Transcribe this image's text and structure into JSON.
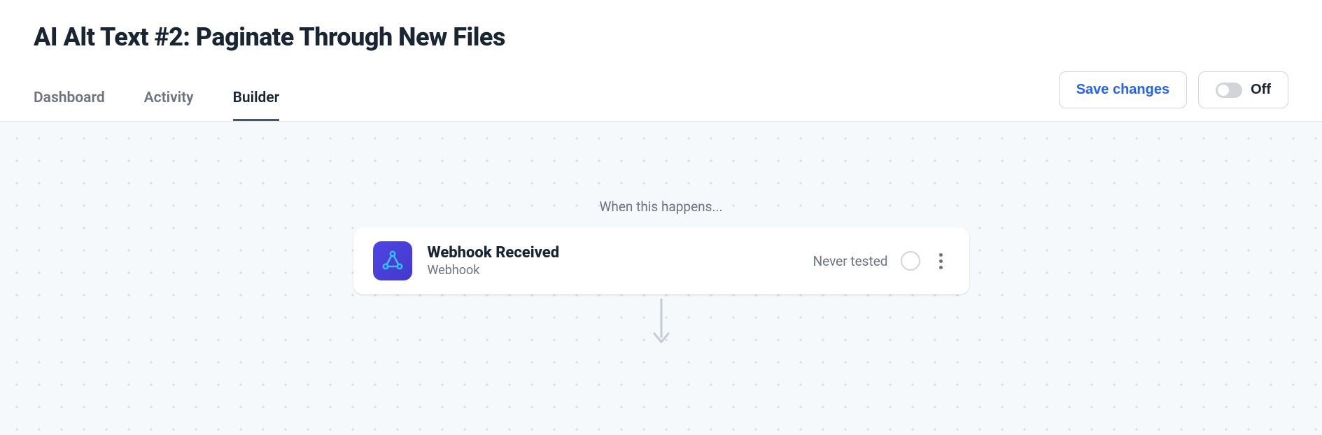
{
  "page": {
    "title": "AI Alt Text #2: Paginate Through New Files"
  },
  "tabs": [
    {
      "label": "Dashboard",
      "active": false
    },
    {
      "label": "Activity",
      "active": false
    },
    {
      "label": "Builder",
      "active": true
    }
  ],
  "actions": {
    "save_label": "Save changes",
    "toggle_label": "Off",
    "toggle_state": "off"
  },
  "builder": {
    "trigger_prompt": "When this happens...",
    "trigger_card": {
      "icon": "webhook-icon",
      "title": "Webhook Received",
      "subtitle": "Webhook",
      "status_text": "Never tested"
    }
  },
  "colors": {
    "accent": "#2563eb",
    "icon_gradient_start": "#4f46e5",
    "icon_gradient_end": "#4338ca",
    "webhook_stroke": "#38bdf8"
  }
}
